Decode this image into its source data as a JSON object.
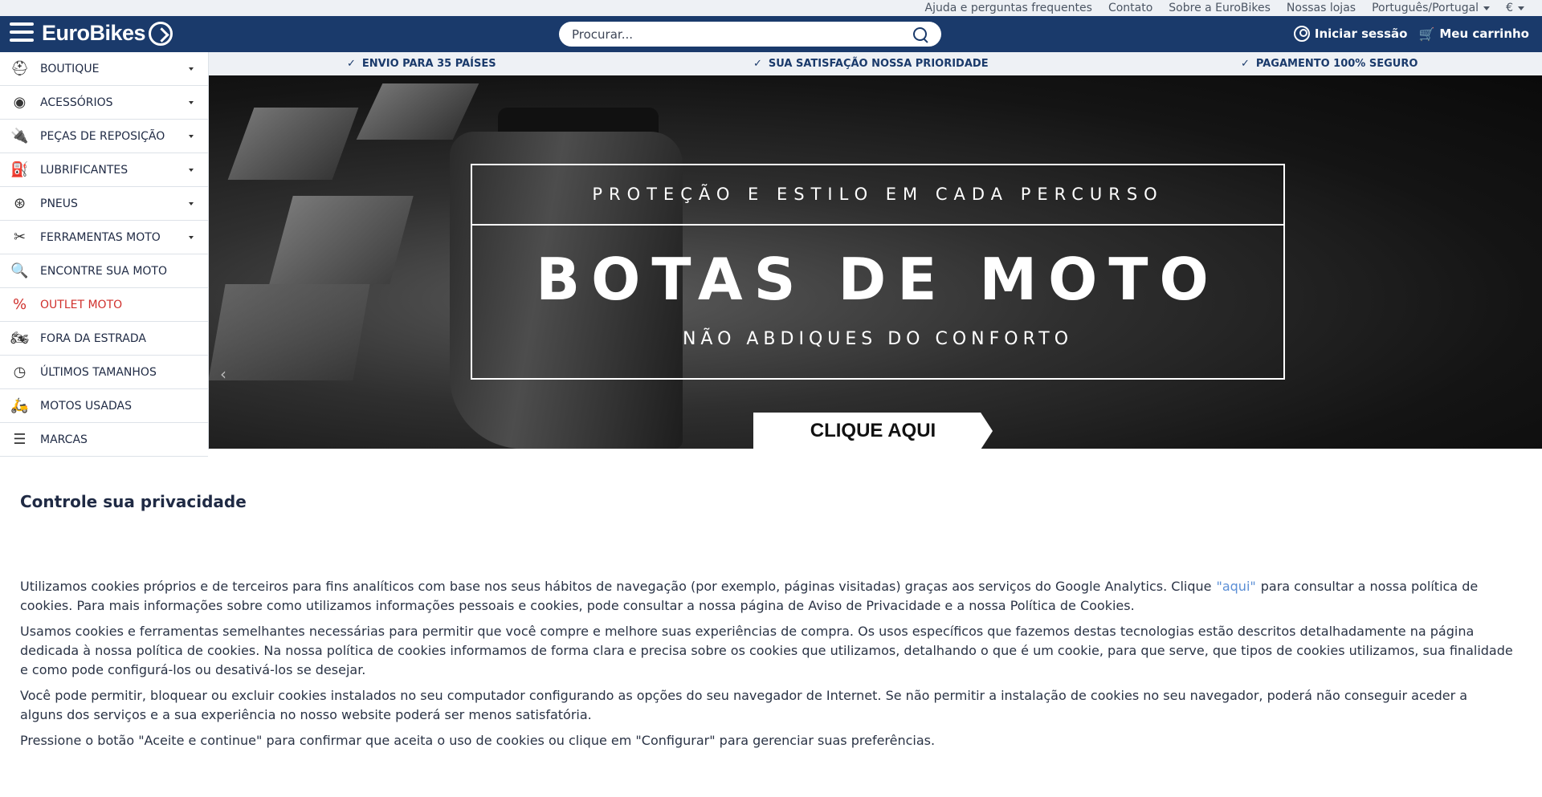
{
  "topbar": {
    "links": [
      "Ajuda e perguntas frequentes",
      "Contato",
      "Sobre a EuroBikes",
      "Nossas lojas"
    ],
    "language": "Português/Portugal",
    "currency": "€"
  },
  "header": {
    "logo": "EuroBikes",
    "search_placeholder": "Procurar...",
    "login": "Iniciar sessão",
    "cart": "Meu carrinho"
  },
  "sidebar": {
    "items": [
      {
        "label": "BOUTIQUE",
        "icon": "helmet-icon",
        "dropdown": true
      },
      {
        "label": "ACESSÓRIOS",
        "icon": "headlight-icon",
        "dropdown": true
      },
      {
        "label": "PEÇAS DE REPOSIÇÃO",
        "icon": "spark-plug-icon",
        "dropdown": true
      },
      {
        "label": "LUBRIFICANTES",
        "icon": "oil-can-icon",
        "dropdown": true
      },
      {
        "label": "PNEUS",
        "icon": "tire-icon",
        "dropdown": true
      },
      {
        "label": "FERRAMENTAS MOTO",
        "icon": "tools-icon",
        "dropdown": true
      },
      {
        "label": "ENCONTRE SUA MOTO",
        "icon": "search-bike-icon",
        "dropdown": false
      },
      {
        "label": "OUTLET MOTO",
        "icon": "discount-icon",
        "dropdown": false,
        "color": "#d0312d"
      },
      {
        "label": "FORA DA ESTRADA",
        "icon": "offroad-icon",
        "dropdown": false
      },
      {
        "label": "ÚLTIMOS TAMANHOS",
        "icon": "clock-icon",
        "dropdown": false
      },
      {
        "label": "MOTOS USADAS",
        "icon": "motorbike-icon",
        "dropdown": false
      },
      {
        "label": "MARCAS",
        "icon": "list-icon",
        "dropdown": false
      }
    ]
  },
  "strip": {
    "items": [
      "ENVIO PARA 35 PAÍSES",
      "SUA SATISFAÇÃO NOSSA PRIORIDADE",
      "PAGAMENTO 100% SEGURO"
    ]
  },
  "hero": {
    "line1": "PROTEÇÃO E ESTILO EM CADA PERCURSO",
    "line2": "BOTAS DE MOTO",
    "line3": "NÃO ABDIQUES DO CONFORTO",
    "cta": "CLIQUE AQUI"
  },
  "privacy": {
    "title": "Controle sua privacidade",
    "p1_a": "Utilizamos cookies próprios e de terceiros para fins analíticos com base nos seus hábitos de navegação (por exemplo, páginas visitadas) graças aos serviços do Google Analytics. Clique",
    "p1_link": "\"aqui\"",
    "p1_b": "para consultar a nossa política de cookies. Para mais informações sobre como utilizamos informações pessoais e cookies, pode consultar a nossa página de Aviso de Privacidade e a nossa Política de Cookies.",
    "p2": "Usamos cookies e ferramentas semelhantes necessárias para permitir que você compre e melhore suas experiências de compra. Os usos específicos que fazemos destas tecnologias estão descritos detalhadamente na página dedicada à nossa política de cookies. Na nossa política de cookies informamos de forma clara e precisa sobre os cookies que utilizamos, detalhando o que é um cookie, para que serve, que tipos de cookies utilizamos, sua finalidade e como pode configurá-los ou desativá-los se desejar.",
    "p3": "Você pode permitir, bloquear ou excluir cookies instalados no seu computador configurando as opções do seu navegador de Internet. Se não permitir a instalação de cookies no seu navegador, poderá não conseguir aceder a alguns dos serviços e a sua experiência no nosso website poderá ser menos satisfatória.",
    "p4": "Pressione o botão \"Aceite e continue\" para confirmar que aceita o uso de cookies ou clique em \"Configurar\" para gerenciar suas preferências."
  }
}
